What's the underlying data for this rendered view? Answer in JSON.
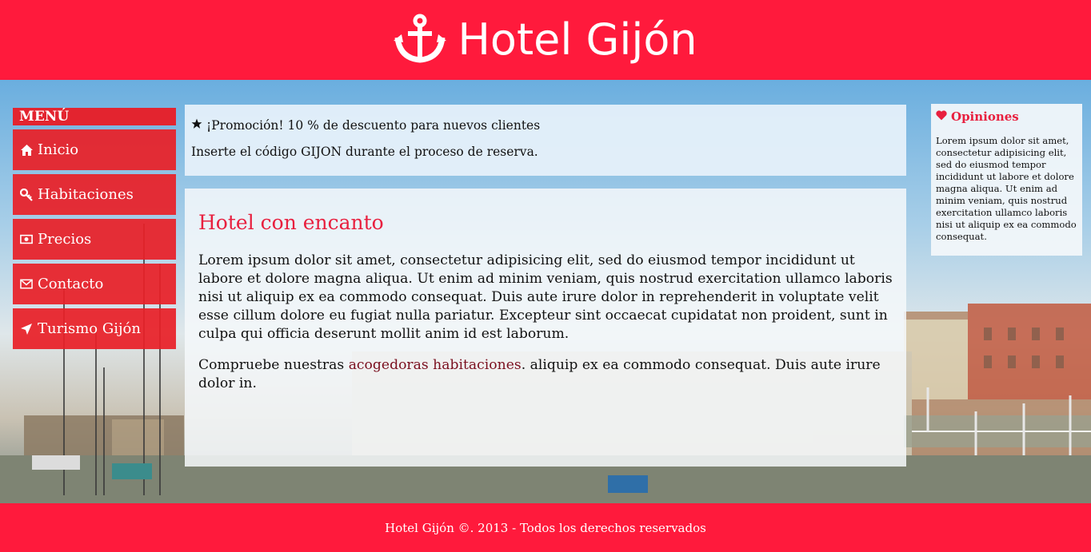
{
  "header": {
    "title": "Hotel Gijón",
    "logo_icon": "anchor-icon",
    "background": "#ff1a3c"
  },
  "menu": {
    "heading": "MENÚ",
    "items": [
      {
        "label": "Inicio",
        "icon": "home-icon"
      },
      {
        "label": "Habitaciones",
        "icon": "key-icon"
      },
      {
        "label": "Precios",
        "icon": "money-icon"
      },
      {
        "label": "Contacto",
        "icon": "envelope-icon"
      },
      {
        "label": "Turismo Gijón",
        "icon": "location-arrow-icon"
      }
    ]
  },
  "promo": {
    "icon": "star-icon",
    "headline": "¡Promoción! 10 % de descuento para nuevos clientes",
    "text": "Inserte el código GIJON durante el proceso de reserva."
  },
  "main": {
    "heading": "Hotel con encanto",
    "paragraph1": "Lorem ipsum dolor sit amet, consectetur adipisicing elit, sed do eiusmod tempor incididunt ut labore et dolore magna aliqua. Ut enim ad minim veniam, quis nostrud exercitation ullamco laboris nisi ut aliquip ex ea commodo consequat. Duis aute irure dolor in reprehenderit in voluptate velit esse cillum dolore eu fugiat nulla pariatur. Excepteur sint occaecat cupidatat non proident, sunt in culpa qui officia deserunt mollit anim id est laborum.",
    "paragraph2_before": "Compruebe nuestras ",
    "paragraph2_link": "acogedoras habitaciones",
    "paragraph2_after": ". aliquip ex ea commodo consequat. Duis aute irure dolor in."
  },
  "opinions": {
    "icon": "heart-icon",
    "title": "Opiniones",
    "text": "Lorem ipsum dolor sit amet, consectetur adipisicing elit, sed do eiusmod tempor incididunt ut labore et dolore magna aliqua. Ut enim ad minim veniam, quis nostrud exercitation ullamco laboris nisi ut aliquip ex ea commodo consequat."
  },
  "footer": {
    "text": "Hotel Gijón ©. 2013 - Todos los derechos reservados"
  },
  "colors": {
    "accent": "#ff1a3c",
    "heading_red": "#e8203f",
    "menu_red": "#e82028",
    "link": "#7a0f1e"
  }
}
